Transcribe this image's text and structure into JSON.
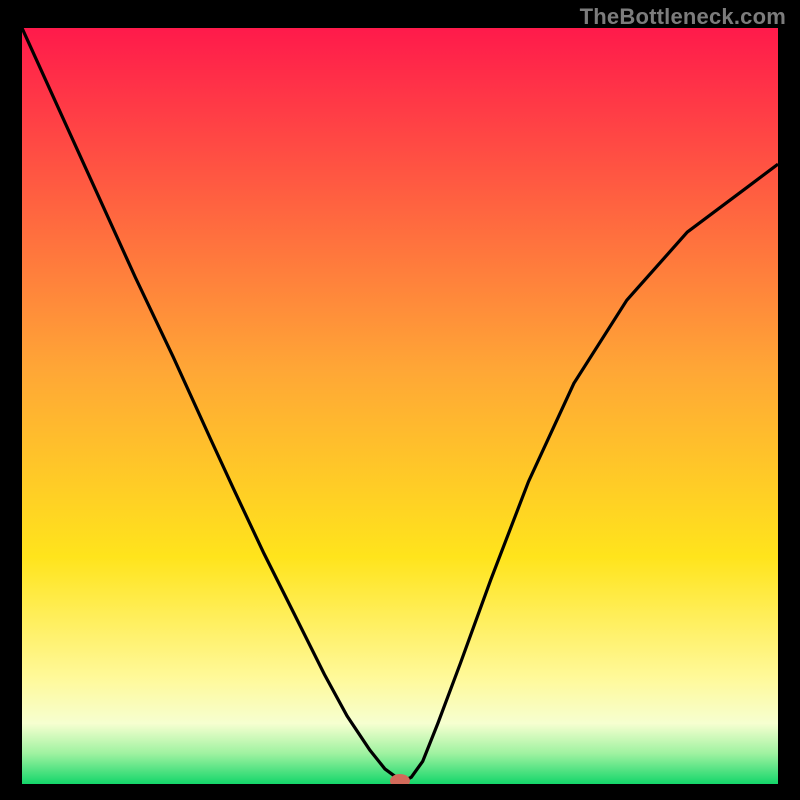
{
  "watermark": "TheBottleneck.com",
  "chart_data": {
    "type": "line",
    "title": "",
    "xlabel": "",
    "ylabel": "",
    "xlim": [
      0,
      100
    ],
    "ylim": [
      0,
      100
    ],
    "background_gradient": {
      "stops": [
        {
          "pos": 0.0,
          "color": "#ff1a4b"
        },
        {
          "pos": 0.45,
          "color": "#ffa636"
        },
        {
          "pos": 0.7,
          "color": "#ffe41c"
        },
        {
          "pos": 0.86,
          "color": "#fff99a"
        },
        {
          "pos": 0.92,
          "color": "#f6ffd0"
        },
        {
          "pos": 0.96,
          "color": "#9ef2a0"
        },
        {
          "pos": 1.0,
          "color": "#14d66a"
        }
      ]
    },
    "series": [
      {
        "name": "bottleneck-curve",
        "type": "line",
        "color": "#000000",
        "x": [
          0,
          5,
          10,
          15,
          20,
          25,
          28,
          32,
          36,
          40,
          43,
          46,
          48,
          49.5,
          50.5,
          51.5,
          53,
          55,
          58,
          62,
          67,
          73,
          80,
          88,
          96,
          100
        ],
        "values": [
          100,
          89,
          78,
          67,
          56.5,
          45.5,
          39,
          30.5,
          22.5,
          14.5,
          9,
          4.5,
          2,
          0.9,
          0.4,
          0.9,
          3,
          8,
          16,
          27,
          40,
          53,
          64,
          73,
          79,
          82
        ]
      }
    ],
    "markers": [
      {
        "name": "min-marker",
        "x": 50,
        "y": 0.4,
        "color": "#d26a5a",
        "rx": 10,
        "ry": 7
      }
    ]
  }
}
